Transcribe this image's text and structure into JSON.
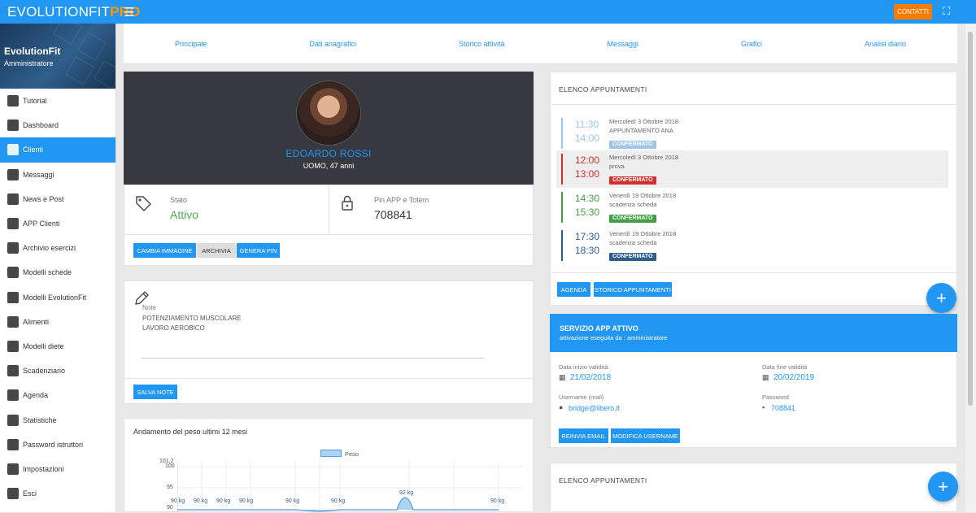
{
  "topbar": {
    "brand_main": "EVOLUTIONFIT",
    "brand_accent": "PRO",
    "contact_label": "CONTATTI"
  },
  "sidebar": {
    "profile_name": "EvolutionFit",
    "profile_role": "Amministratore",
    "items": [
      {
        "label": "Tutorial",
        "icon": "clapperboard-icon"
      },
      {
        "label": "Dashboard",
        "icon": "chart-icon"
      },
      {
        "label": "Clienti",
        "icon": "users-icon"
      },
      {
        "label": "Messaggi",
        "icon": "message-icon"
      },
      {
        "label": "News e Post",
        "icon": "megaphone-icon"
      },
      {
        "label": "APP Clienti",
        "icon": "mobile-icon"
      },
      {
        "label": "Archivio esercizi",
        "icon": "exercise-icon"
      },
      {
        "label": "Modelli schede",
        "icon": "document-icon"
      },
      {
        "label": "Modelli EvolutionFit",
        "icon": "document-icon"
      },
      {
        "label": "Alimenti",
        "icon": "apple-icon"
      },
      {
        "label": "Modelli diete",
        "icon": "plate-icon"
      },
      {
        "label": "Scadenziario",
        "icon": "calendar-icon"
      },
      {
        "label": "Agenda",
        "icon": "calendar-grid-icon"
      },
      {
        "label": "Statistiche",
        "icon": "bar-chart-icon"
      },
      {
        "label": "Password istruttori",
        "icon": "lock-icon"
      },
      {
        "label": "Impostazioni",
        "icon": "gear-icon"
      },
      {
        "label": "Esci",
        "icon": "power-icon"
      }
    ]
  },
  "tabs": [
    "Principale",
    "Dati anagrafici",
    "Storico attività",
    "Messaggi",
    "Grafici",
    "Analisi diario"
  ],
  "client": {
    "name": "EDOARDO ROSSI",
    "subtitle": "UOMO, 47 anni",
    "state_label": "Stato",
    "state_value": "Attivo",
    "pin_label": "Pin APP e Totem",
    "pin_value": "708841",
    "btn_change_image": "CAMBIA IMMAGINE",
    "btn_archive": "ARCHIVIA",
    "btn_generate_pin": "GENERA PIN"
  },
  "notes": {
    "label": "Note",
    "line1": "POTENZIAMENTO MUSCOLARE",
    "line2": "LAVORO AEROBICO",
    "save_label": "SALVA NOTE"
  },
  "weight_chart": {
    "title": "Andamento del peso ultimi 12 mesi",
    "legend": "Peso",
    "ticks": [
      "101,2",
      "100",
      "95",
      "90"
    ]
  },
  "appointments": {
    "title": "ELENCO APPUNTAMENTI",
    "items": [
      {
        "start": "11:30",
        "end": "14:00",
        "date": "Mercoledì 3 Ottobre 2018",
        "desc": "APPUNTAMENTO ANA",
        "status": "CONFERMATO",
        "color": "#9fc5ea",
        "highlight": false
      },
      {
        "start": "12:00",
        "end": "13:00",
        "date": "Mercoledì 3 Ottobre 2018",
        "desc": "prova",
        "status": "CONFERMATO",
        "color": "#d32f2f",
        "highlight": true
      },
      {
        "start": "14:30",
        "end": "15:30",
        "date": "Venerdì 19 Ottobre 2018",
        "desc": "scadenza scheda",
        "status": "CONFERMATO",
        "color": "#43a047",
        "highlight": false
      },
      {
        "start": "17:30",
        "end": "18:30",
        "date": "Venerdì 19 Ottobre 2018",
        "desc": "scadenza scheda",
        "status": "CONFERMATO",
        "color": "#2e5e8e",
        "highlight": false
      }
    ],
    "btn_agenda": "AGENDA",
    "btn_history": "STORICO APPUNTAMENTI"
  },
  "service": {
    "title": "SERVIZIO APP ATTIVO",
    "subtitle": "attivazione eseguita da : amministratore",
    "start_label": "Data inizio validità",
    "start_value": "21/02/2018",
    "end_label": "Data fine validità",
    "end_value": "20/02/2019",
    "user_label": "Username (mail)",
    "user_value": "bridge@libero.it",
    "pwd_label": "Password",
    "pwd_value": "708841",
    "btn_resend": "REINVIA EMAIL",
    "btn_modify": "MODIFICA USERNAME"
  },
  "appointments2": {
    "title": "ELENCO APPUNTAMENTI"
  }
}
